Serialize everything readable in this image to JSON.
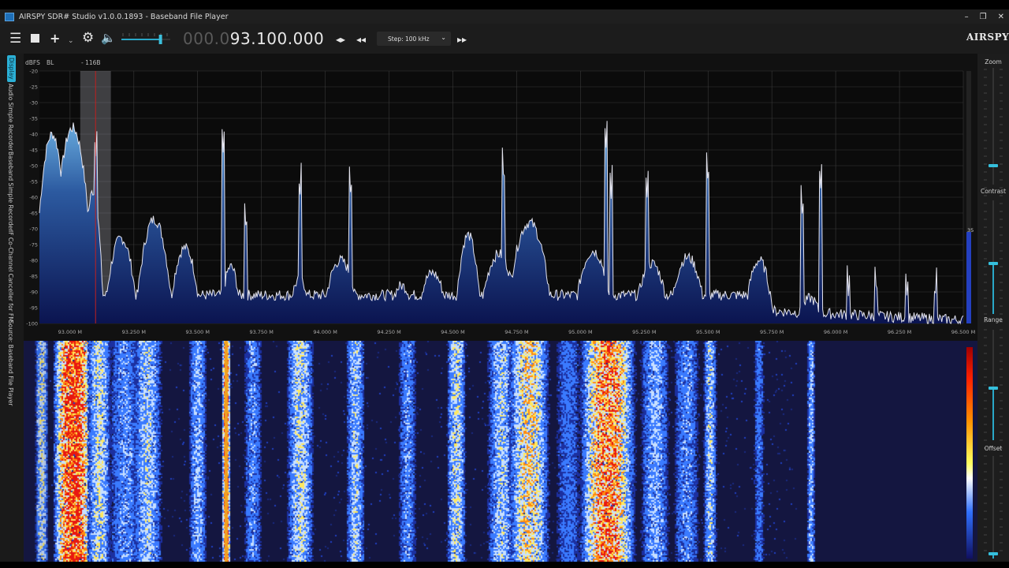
{
  "window": {
    "title": "AIRSPY SDR# Studio v1.0.0.1893 - Baseband File Player",
    "min_icon": "minimize-icon",
    "restore_icon": "restore-icon",
    "close_icon": "close-icon"
  },
  "toolbar": {
    "frequency_dim": "000.0",
    "frequency_bright": "93.100.000",
    "step_label": "Step: 100 kHz",
    "logo": "AIRSPY",
    "volume_level": 0.8
  },
  "left_tabs": [
    {
      "label": "Display"
    },
    {
      "label": "Audio Simple Recorder"
    },
    {
      "label": "Baseband Simple Recorder"
    },
    {
      "label": "IF Co-Channel Canceller for FM"
    },
    {
      "label": "Source: Baseband File Player"
    }
  ],
  "spectrum": {
    "unit_label": "dBFS",
    "bl_label": "BL",
    "marker_label": "- 116B",
    "level_value": "35",
    "y_ticks": [
      "-20",
      "-25",
      "-30",
      "-35",
      "-40",
      "-45",
      "-50",
      "-55",
      "-60",
      "-65",
      "-70",
      "-75",
      "-80",
      "-85",
      "-90",
      "-95",
      "-100"
    ],
    "x_ticks": [
      "93.000 M",
      "93.250 M",
      "93.500 M",
      "93.750 M",
      "94.000 M",
      "94.250 M",
      "94.500 M",
      "94.750 M",
      "95.000 M",
      "95.250 M",
      "95.500 M",
      "95.750 M",
      "96.000 M",
      "96.250 M",
      "96.500 M"
    ],
    "x_range": [
      92.88,
      96.5
    ],
    "y_range": [
      -100,
      -20
    ],
    "tuned_mhz": 93.1,
    "filter_mhz": [
      93.04,
      93.16
    ],
    "colors": {
      "fill_top": "#5aa0d8",
      "fill_bottom": "#0a1550",
      "line": "#e8e8f0",
      "grid": "#3a3a3a",
      "tune": "#c02020"
    }
  },
  "right_panel": {
    "zoom_label": "Zoom",
    "contrast_label": "Contrast",
    "range_label": "Range",
    "offset_label": "Offset"
  }
}
